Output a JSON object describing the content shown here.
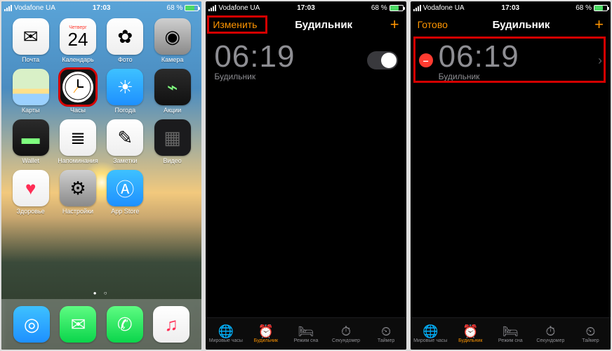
{
  "status": {
    "carrier": "Vodafone UA",
    "time": "17:03",
    "battery": "68 %"
  },
  "home": {
    "apps": [
      {
        "label": "Почта",
        "glyph": "✉︎",
        "cls": "bg-white"
      },
      {
        "label": "Календарь",
        "glyph": "24",
        "cls": "bg-white",
        "day": "Четверг"
      },
      {
        "label": "Фото",
        "glyph": "✿",
        "cls": "bg-white"
      },
      {
        "label": "Камера",
        "glyph": "◉",
        "cls": "bg-grey"
      },
      {
        "label": "Карты",
        "glyph": "",
        "cls": "maps"
      },
      {
        "label": "Часы",
        "glyph": "clock",
        "cls": "bg-clock",
        "highlight": true
      },
      {
        "label": "Погода",
        "glyph": "☀︎",
        "cls": "bg-blue"
      },
      {
        "label": "Акции",
        "glyph": "⌁",
        "cls": "bg-dark"
      },
      {
        "label": "Wallet",
        "glyph": "▬",
        "cls": "bg-dark"
      },
      {
        "label": "Напоминания",
        "glyph": "≣",
        "cls": "bg-white"
      },
      {
        "label": "Заметки",
        "glyph": "✎",
        "cls": "bg-white"
      },
      {
        "label": "Видео",
        "glyph": "▦",
        "cls": "blank"
      },
      {
        "label": "Здоровье",
        "glyph": "♥︎",
        "cls": "bg-white",
        "color": "#ff2d55"
      },
      {
        "label": "Настройки",
        "glyph": "⚙︎",
        "cls": "bg-grey"
      },
      {
        "label": "App Store",
        "glyph": "Ⓐ",
        "cls": "bg-blue"
      }
    ],
    "dock": [
      {
        "name": "safari",
        "glyph": "◎",
        "cls": "bg-blue"
      },
      {
        "name": "messages",
        "glyph": "✉︎",
        "cls": "bg-green"
      },
      {
        "name": "phone",
        "glyph": "✆",
        "cls": "bg-green"
      },
      {
        "name": "music",
        "glyph": "♫",
        "cls": "bg-white",
        "color": "#ff2d55"
      }
    ]
  },
  "alarm": {
    "nav_edit": "Изменить",
    "nav_done": "Готово",
    "nav_title": "Будильник",
    "time": "06:19",
    "sub": "Будильник",
    "tabs": [
      {
        "label": "Мировые часы",
        "glyph": "🌐"
      },
      {
        "label": "Будильник",
        "glyph": "⏰",
        "active": true
      },
      {
        "label": "Режим сна",
        "glyph": "🛏"
      },
      {
        "label": "Секундомер",
        "glyph": "⏱"
      },
      {
        "label": "Таймер",
        "glyph": "⏲"
      }
    ]
  }
}
